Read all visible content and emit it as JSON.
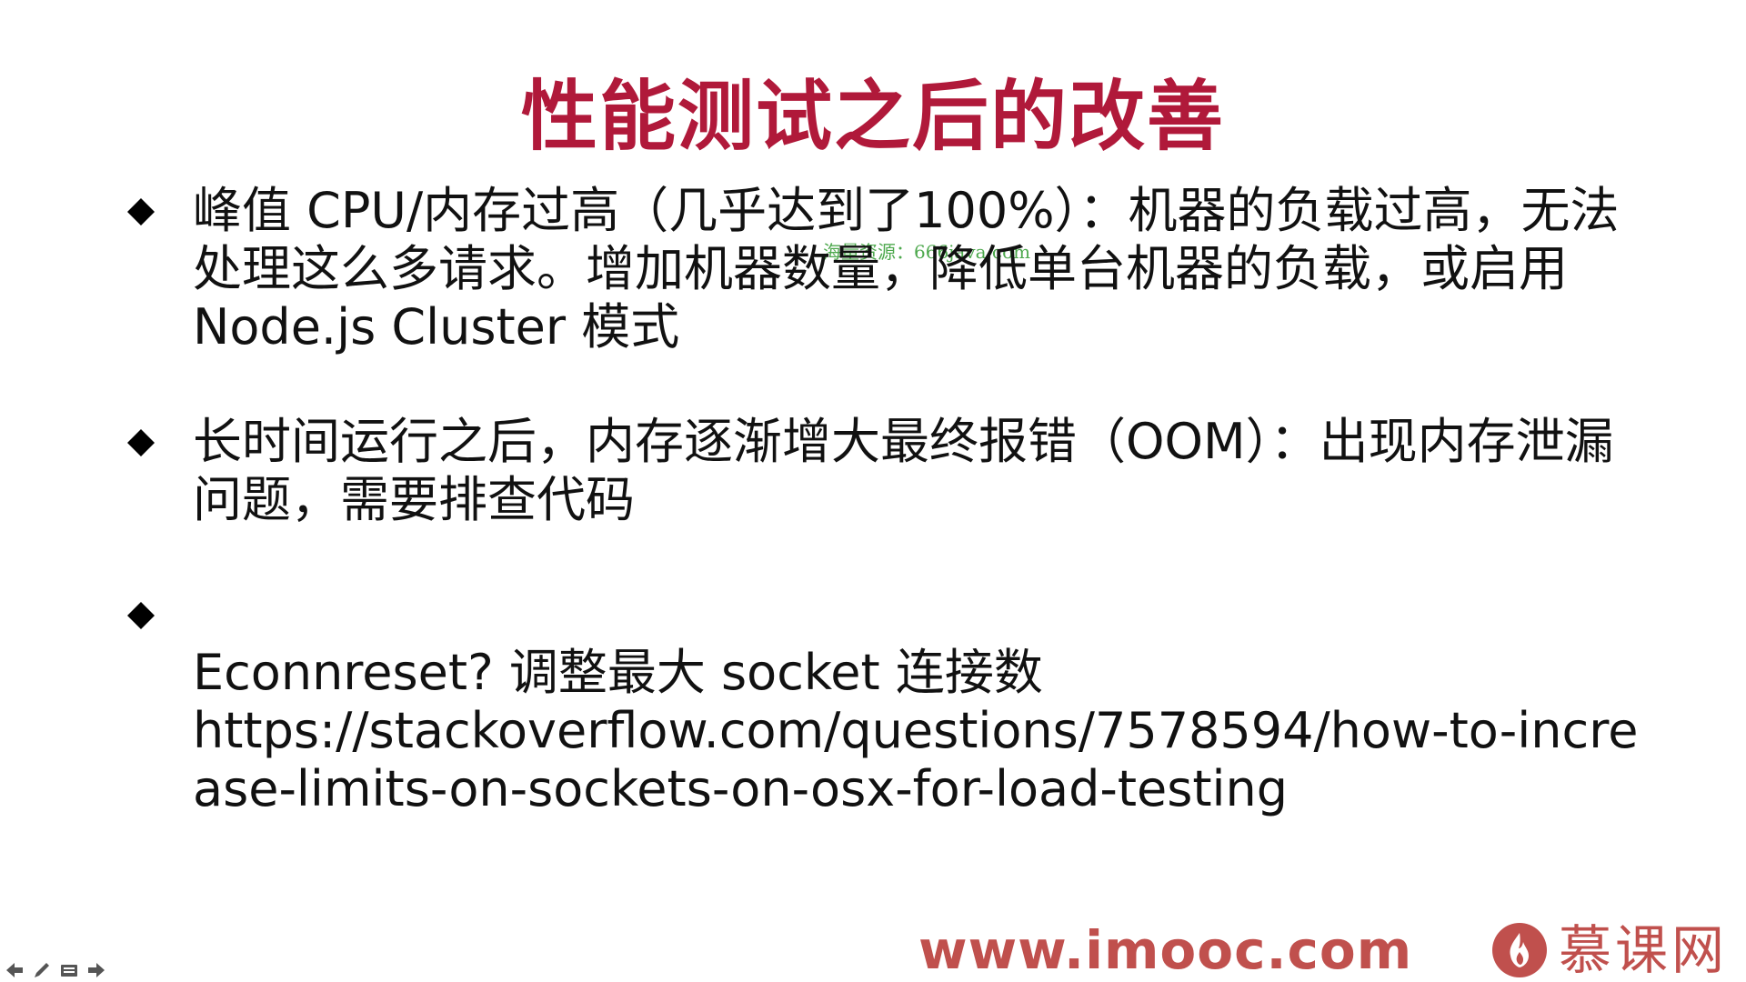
{
  "slide": {
    "title": "性能测试之后的改善",
    "watermark": "海量资源：666java.com",
    "bullets": [
      {
        "text": "峰值 CPU/内存过高（几乎达到了100%）：机器的负载过高，无法\n处理这么多请求。增加机器数量，降低单台机器的负载，或启用\nNode.js Cluster 模式"
      },
      {
        "text": "长时间运行之后，内存逐渐增大最终报错（OOM）：出现内存泄漏\n问题，需要排查代码"
      },
      {
        "text": "Econnreset? 调整最大 socket 连接数",
        "link": "https://stackoverflow.com/questions/7578594/how-to-increase-limits-on-sockets-on-osx-for-load-testing"
      }
    ]
  },
  "footer": {
    "site_url": "www.imooc.com",
    "brand_name": "慕课网"
  },
  "toolbar": {
    "icons": [
      "arrow-left-icon",
      "pen-icon",
      "slides-menu-icon",
      "arrow-right-icon"
    ]
  },
  "colors": {
    "title": "#b0193a",
    "bullet_icon": "#000000",
    "watermark": "#2e9a2e",
    "brand": "#c0504d",
    "toolbar_icon": "#555555"
  }
}
